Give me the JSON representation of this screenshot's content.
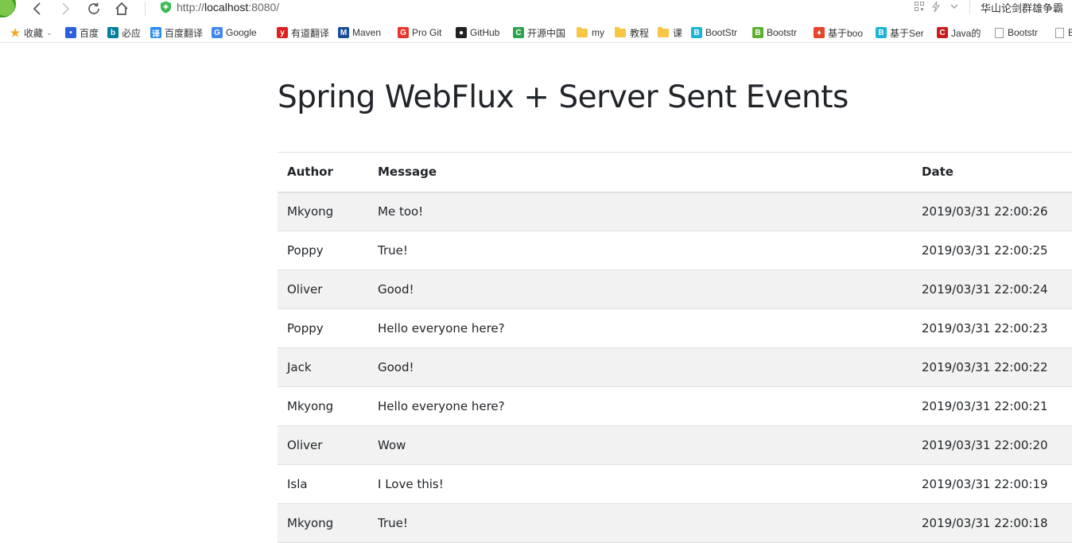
{
  "browser": {
    "url_prefix": "http://",
    "url_host": "localhost",
    "url_suffix": ":8080/",
    "app_title": "华山论剑群雄争霸"
  },
  "bookmarks": [
    {
      "label": "收藏",
      "icon": "star-icon",
      "color": "#f5a623"
    },
    {
      "label": "百度",
      "icon": "baidu-icon",
      "color": "#2b60de"
    },
    {
      "label": "必应",
      "icon": "bing-icon",
      "color": "#00809d"
    },
    {
      "label": "百度翻译",
      "icon": "translate-icon",
      "color": "#2d8cf0"
    },
    {
      "label": "Google",
      "icon": "google-translate-icon",
      "color": "#4285f4"
    },
    {
      "label": "有道翻译",
      "icon": "youdao-icon",
      "color": "#e02020"
    },
    {
      "label": "Maven",
      "icon": "maven-icon",
      "color": "#1a4c9a"
    },
    {
      "label": "Pro Git",
      "icon": "progit-icon",
      "color": "#e8352c"
    },
    {
      "label": "GitHub",
      "icon": "github-icon",
      "color": "#222222"
    },
    {
      "label": "开源中国",
      "icon": "oschina-icon",
      "color": "#2ea44f"
    },
    {
      "label": "my",
      "icon": "folder-icon"
    },
    {
      "label": "教程",
      "icon": "folder-icon"
    },
    {
      "label": "课",
      "icon": "folder-icon"
    },
    {
      "label": "BootStr",
      "icon": "bootstrap-icon",
      "color": "#1fb3d6"
    },
    {
      "label": "Bootstr",
      "icon": "bootstrap-icon",
      "color": "#5fae2e"
    },
    {
      "label": "基于boo",
      "icon": "flame-icon",
      "color": "#e8462c"
    },
    {
      "label": "基于Ser",
      "icon": "bootstrap-icon",
      "color": "#1fb3d6"
    },
    {
      "label": "Java的",
      "icon": "csdn-icon",
      "color": "#c91d1d"
    },
    {
      "label": "Bootstr",
      "icon": "page-icon"
    },
    {
      "label": "B",
      "icon": "page-icon"
    }
  ],
  "page": {
    "title": "Spring WebFlux + Server Sent Events"
  },
  "table": {
    "headers": {
      "author": "Author",
      "message": "Message",
      "date": "Date"
    },
    "rows": [
      {
        "author": "Mkyong",
        "message": "Me too!",
        "date": "2019/03/31 22:00:26"
      },
      {
        "author": "Poppy",
        "message": "True!",
        "date": "2019/03/31 22:00:25"
      },
      {
        "author": "Oliver",
        "message": "Good!",
        "date": "2019/03/31 22:00:24"
      },
      {
        "author": "Poppy",
        "message": "Hello everyone here?",
        "date": "2019/03/31 22:00:23"
      },
      {
        "author": "Jack",
        "message": "Good!",
        "date": "2019/03/31 22:00:22"
      },
      {
        "author": "Mkyong",
        "message": "Hello everyone here?",
        "date": "2019/03/31 22:00:21"
      },
      {
        "author": "Oliver",
        "message": "Wow",
        "date": "2019/03/31 22:00:20"
      },
      {
        "author": "Isla",
        "message": "I Love this!",
        "date": "2019/03/31 22:00:19"
      },
      {
        "author": "Mkyong",
        "message": "True!",
        "date": "2019/03/31 22:00:18"
      }
    ]
  }
}
